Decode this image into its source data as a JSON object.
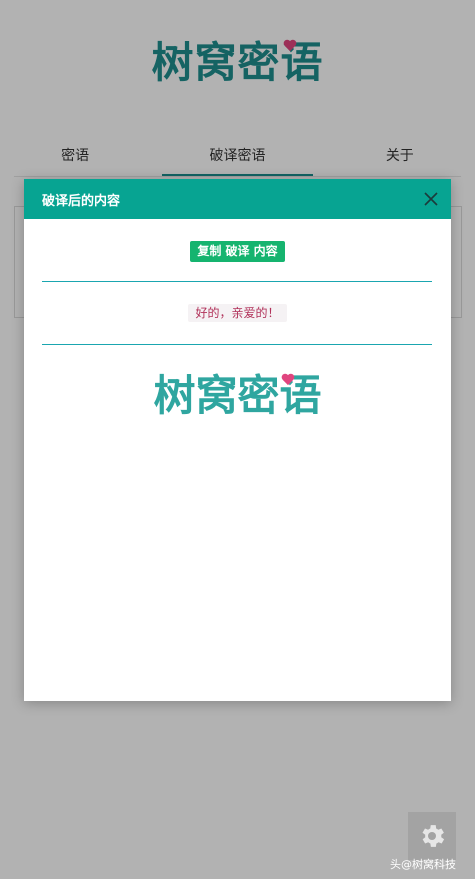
{
  "app": {
    "logo_text": "树窝密语",
    "tabs": [
      {
        "label": "密语",
        "active": false
      },
      {
        "label": "破译密语",
        "active": true
      },
      {
        "label": "关于",
        "active": false
      }
    ]
  },
  "modal": {
    "title": "破译后的内容",
    "copy_button_label": "复制 破译 内容",
    "result_text": "好的，亲爱的！",
    "logo_text": "树窝密语"
  },
  "footer": {
    "watermark": "头@树窝科技"
  },
  "colors": {
    "accent": "#07a492",
    "copy_button": "#15b46f",
    "logo": "#1f8f8f",
    "heart": "#e0457f",
    "result_text": "#b1325a"
  },
  "icons": [
    "close-icon",
    "gear-icon",
    "heart-icon"
  ]
}
